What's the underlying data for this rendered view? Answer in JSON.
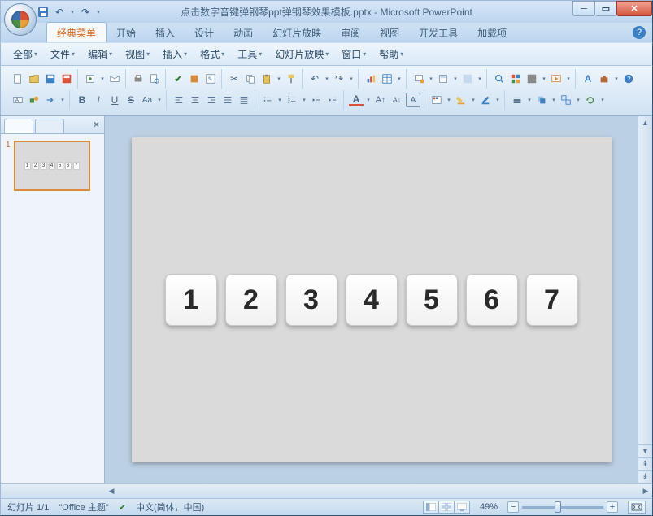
{
  "title": "点击数字音键弹钢琴ppt弹钢琴效果模板.pptx - Microsoft PowerPoint",
  "ribbon_tabs": [
    "经典菜单",
    "开始",
    "插入",
    "设计",
    "动画",
    "幻灯片放映",
    "审阅",
    "视图",
    "开发工具",
    "加载项"
  ],
  "active_tab": 0,
  "classic_menus": [
    "全部",
    "文件",
    "编辑",
    "视图",
    "插入",
    "格式",
    "工具",
    "幻灯片放映",
    "窗口",
    "帮助"
  ],
  "slide": {
    "keys": [
      "1",
      "2",
      "3",
      "4",
      "5",
      "6",
      "7"
    ]
  },
  "thumb": {
    "number": "1",
    "keys": [
      "1",
      "2",
      "3",
      "4",
      "5",
      "6",
      "7"
    ]
  },
  "status": {
    "slide_of": "幻灯片 1/1",
    "theme": "\"Office 主题\"",
    "lang": "中文(简体，中国)",
    "zoom": "49%"
  }
}
